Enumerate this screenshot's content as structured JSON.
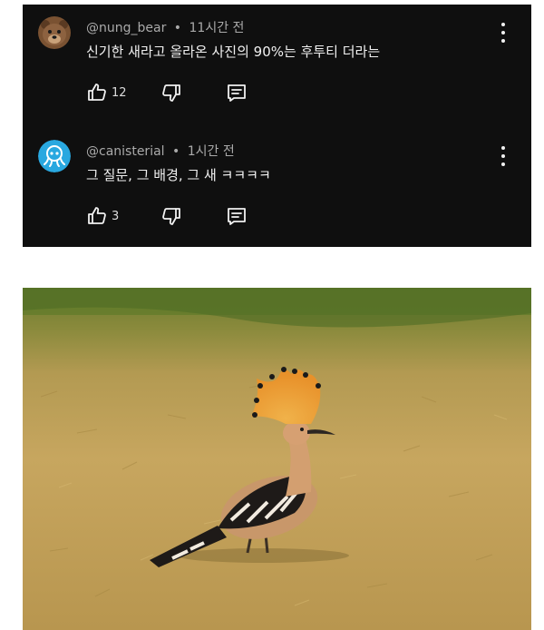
{
  "comments": [
    {
      "username": "@nung_bear",
      "separator": "•",
      "time": "11시간 전",
      "text": "신기한 새라고 올라온 사진의 90%는 후투티 더라는",
      "likes": "12",
      "avatar_icon": "bear-avatar-icon"
    },
    {
      "username": "@canisterial",
      "separator": "•",
      "time": "1시간 전",
      "text": "그 질문, 그 배경, 그 새 ㅋㅋㅋㅋ",
      "likes": "3",
      "avatar_icon": "octopus-avatar-icon"
    }
  ],
  "colors": {
    "panel_bg": "#0f0f0f",
    "meta_text": "#aaaaaa",
    "body_text": "#f1f1f1",
    "avatar_blue": "#29a8e0"
  },
  "photo": {
    "subject_icon": "hoopoe-bird-photo"
  }
}
